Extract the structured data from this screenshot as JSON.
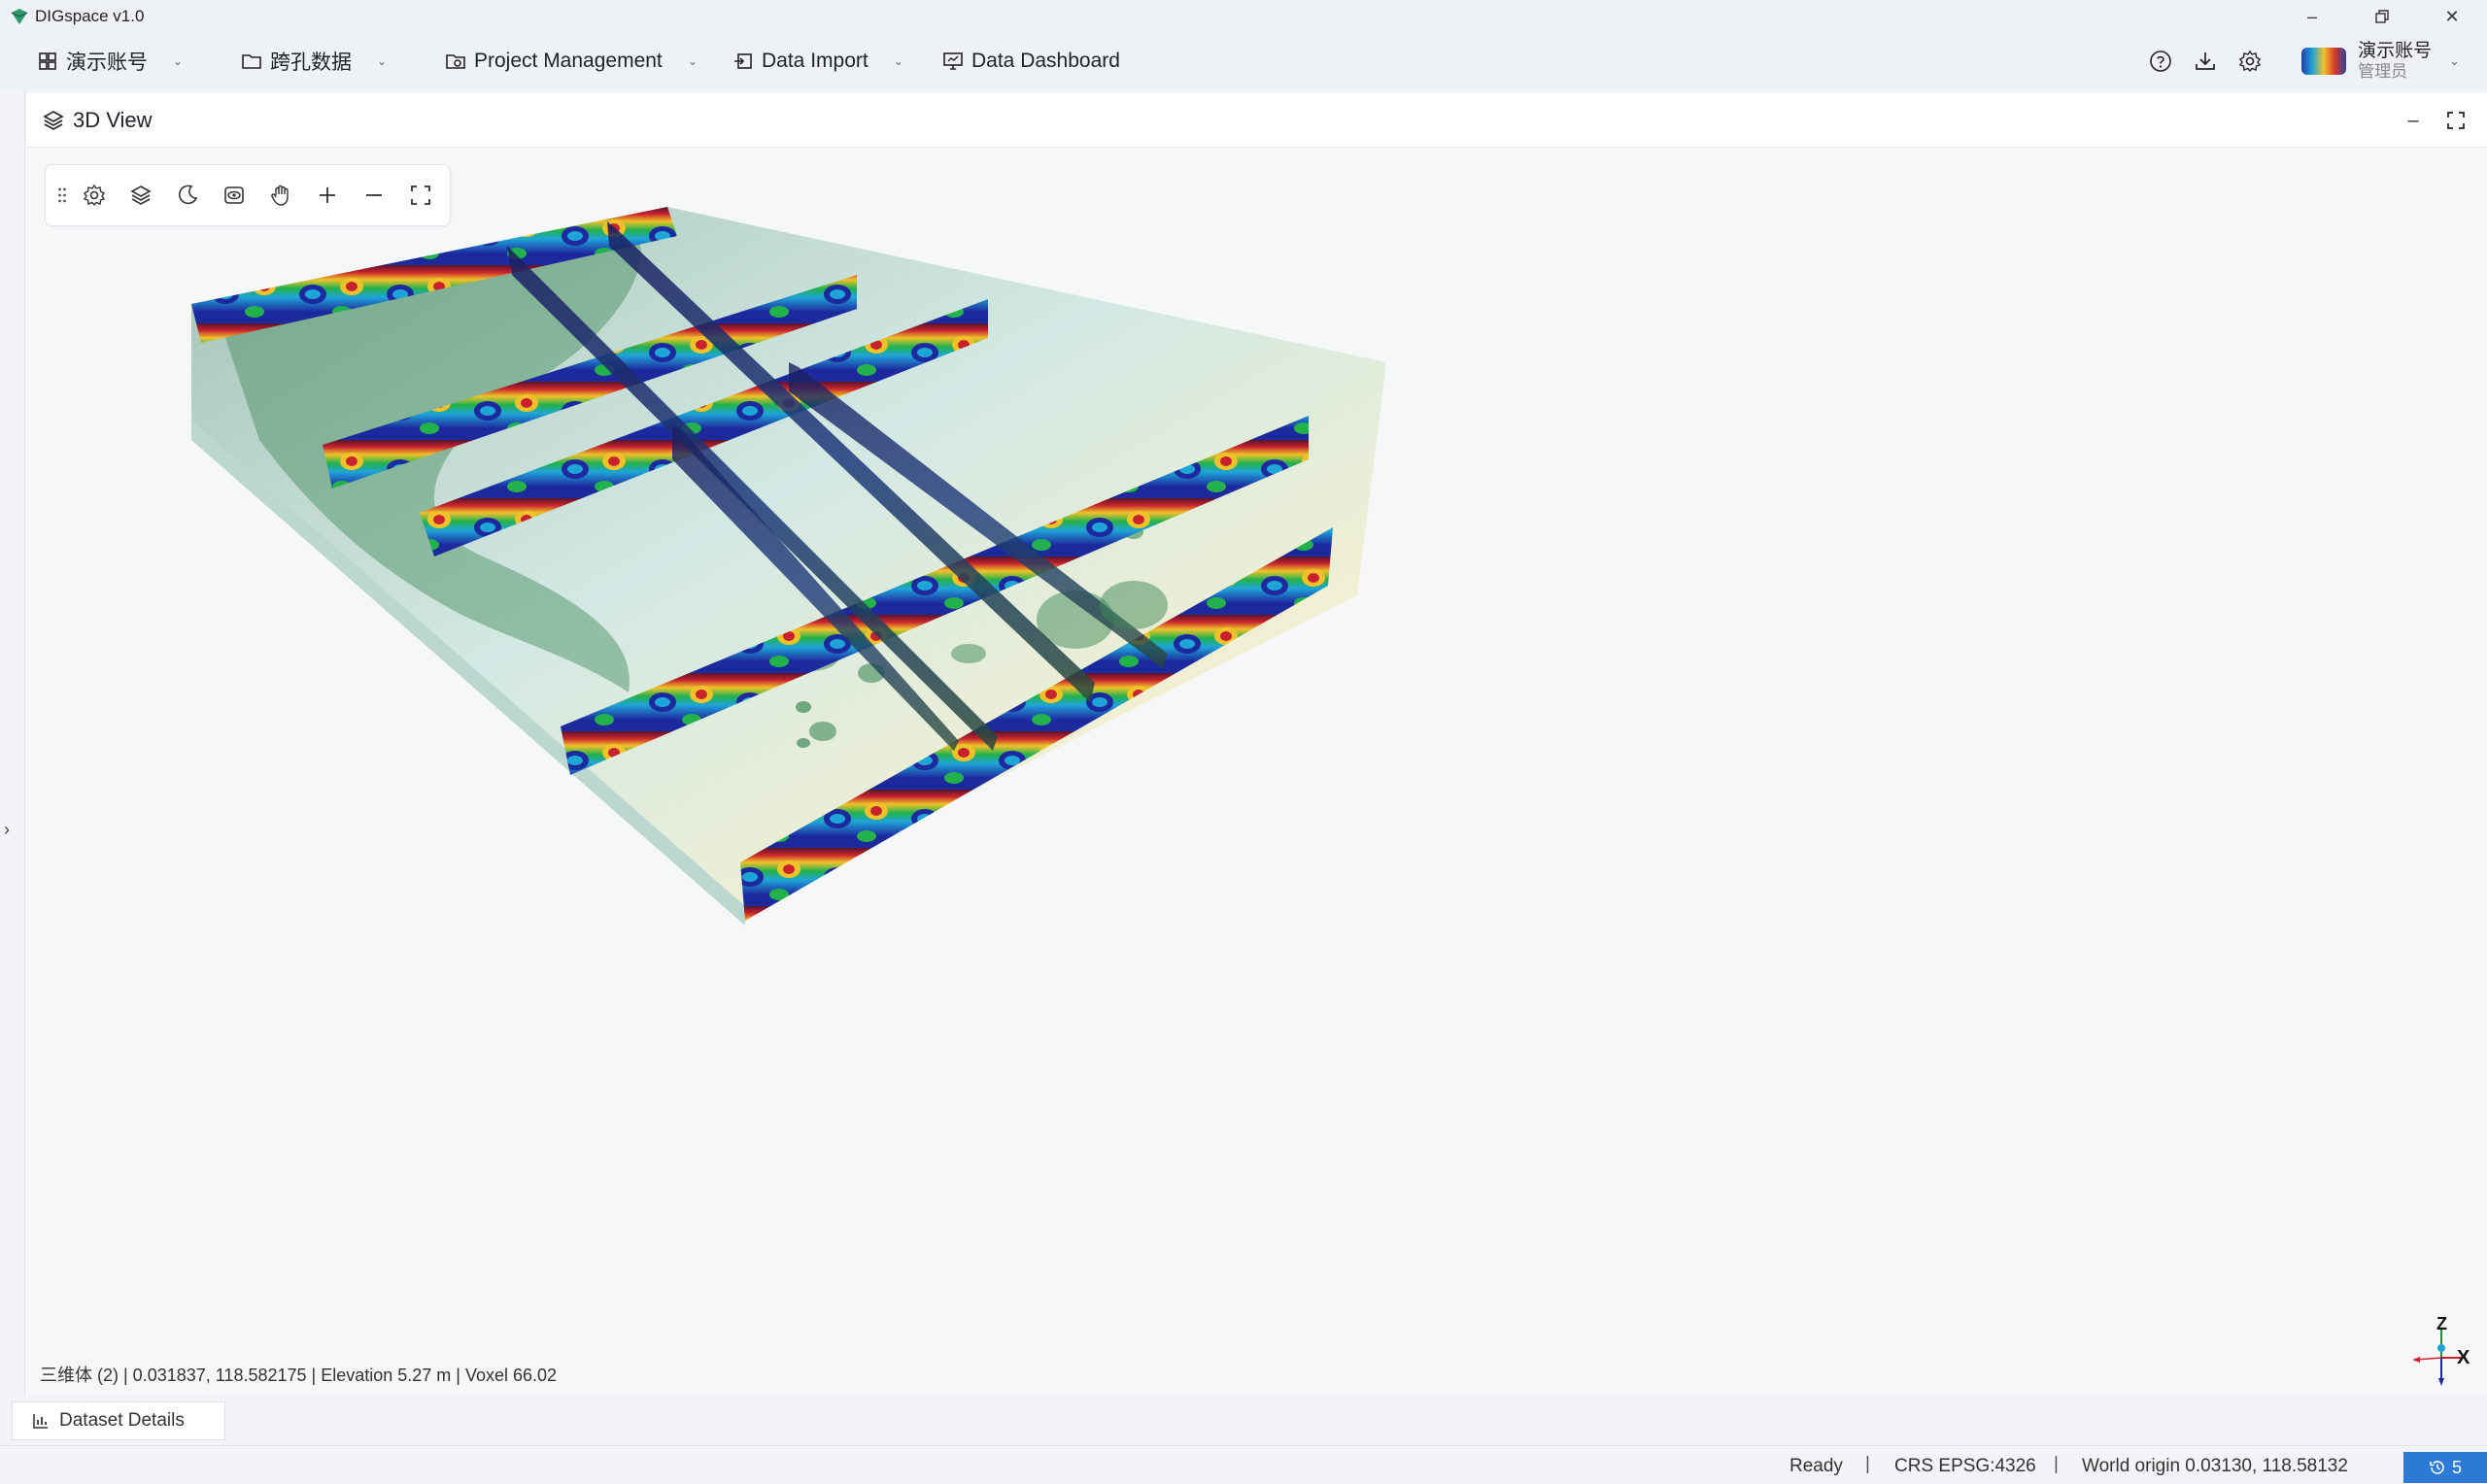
{
  "app": {
    "title": "DIGspace v1.0"
  },
  "menu": {
    "account": "演示账号",
    "borehole": "跨孔数据",
    "project": "Project Management",
    "import": "Data Import",
    "dashboard": "Data Dashboard"
  },
  "user": {
    "name": "演示账号",
    "role": "管理员"
  },
  "panel": {
    "title": "3D View"
  },
  "viewport": {
    "status": "三维体 (2) | 0.031837, 118.582175 | Elevation 5.27 m | Voxel 66.02",
    "axes": {
      "z": "Z",
      "x": "X"
    }
  },
  "dataset_tab": {
    "label": "Dataset Details"
  },
  "statusbar": {
    "ready": "Ready",
    "crs": "CRS EPSG:4326",
    "origin": "World origin  0.03130, 118.58132",
    "badge_count": "5"
  },
  "colors": {
    "accent": "#2c79d6",
    "ert_low": "#1c2a9e",
    "ert_high": "#c8232c"
  }
}
